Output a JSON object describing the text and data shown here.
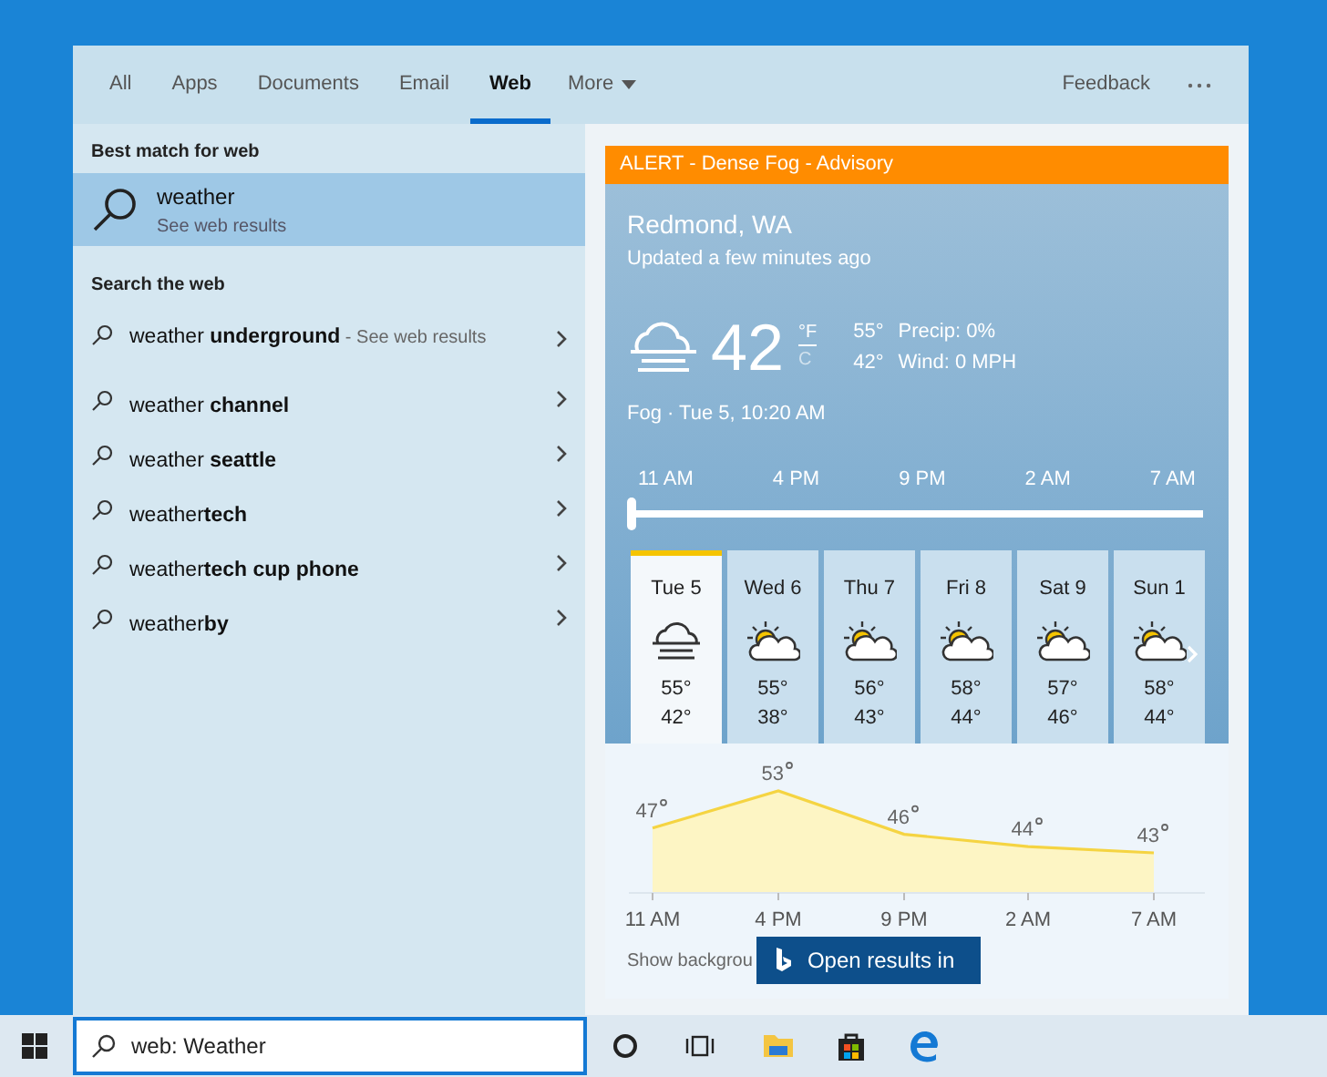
{
  "tabs": [
    {
      "label": "All",
      "selected": false
    },
    {
      "label": "Apps",
      "selected": false
    },
    {
      "label": "Documents",
      "selected": false
    },
    {
      "label": "Email",
      "selected": false
    },
    {
      "label": "Web",
      "selected": true
    }
  ],
  "more_menu": {
    "label": "More"
  },
  "feedback_link": "Feedback",
  "best_match": {
    "heading": "Best match for web",
    "title": "weather",
    "subtitle": "See web results",
    "selected": true
  },
  "web_suggestions": {
    "heading": "Search the web",
    "items": [
      {
        "text": "weather **underground**",
        "note": "- See web results"
      },
      {
        "text": "weather **channel**"
      },
      {
        "text": "weather **seattle**"
      },
      {
        "text": "weather**tech**"
      },
      {
        "text": "weather**tech cup phone**"
      },
      {
        "text": "weather**by**"
      }
    ]
  },
  "weather": {
    "alert": "ALERT - Dense Fog - Advisory",
    "location": "Redmond, WA",
    "updated": "Updated a few minutes ago",
    "temperature": "42",
    "units": [
      {
        "label": "°F",
        "selected": true
      },
      {
        "label": "C",
        "selected": false
      }
    ],
    "high": "55°",
    "low": "42°",
    "precip": "Precip: 0%",
    "wind": "Wind: 0 MPH",
    "condition": "Fog · Tue 5, 10:20 AM",
    "timeline": {
      "labels": [
        "11 AM",
        "4 PM",
        "9 PM",
        "2 AM",
        "7 AM"
      ],
      "level": 0
    },
    "days": [
      {
        "label": "Tue 5",
        "kind": "fog",
        "high": "55°",
        "low": "42°",
        "selected": true
      },
      {
        "label": "Wed 6",
        "kind": "partly_sunny",
        "high": "55°",
        "low": "38°",
        "selected": false
      },
      {
        "label": "Thu 7",
        "kind": "partly_sunny",
        "high": "56°",
        "low": "43°",
        "selected": false
      },
      {
        "label": "Fri 8",
        "kind": "partly_sunny",
        "high": "58°",
        "low": "44°",
        "selected": false
      },
      {
        "label": "Sat 9",
        "kind": "partly_sunny",
        "high": "57°",
        "low": "46°",
        "selected": false
      },
      {
        "label": "Sun 1",
        "kind": "partly_sunny",
        "high": "58°",
        "low": "44°",
        "selected": false
      }
    ],
    "hourly": {
      "chart_data": {
        "type": "area",
        "categories": [
          "11 AM",
          "4 PM",
          "9 PM",
          "2 AM",
          "7 AM"
        ],
        "series": [
          {
            "color": "#f5d442",
            "values": [
              47,
              53,
              46,
              44,
              43
            ]
          }
        ],
        "data_labels": true
      }
    },
    "background_toggle_label": "Show backgrou",
    "open_button": "Open results in"
  },
  "taskbar": {
    "search_value": "web: Weather"
  }
}
